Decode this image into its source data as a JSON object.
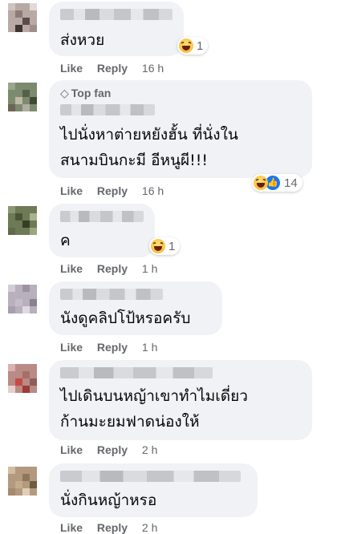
{
  "comments": [
    {
      "text_lines": [
        "ส่งหวย"
      ],
      "reactions": {
        "emojis": [
          "haha-icon"
        ],
        "count": "1"
      },
      "actions": {
        "like": "Like",
        "reply": "Reply",
        "time": "16 h"
      }
    },
    {
      "badge": "Top fan",
      "text_lines": [
        "ไปนั่งหาต่ายหยังฮั้น ที่นั่งใน",
        "สนามบินกะมี อีหนูผี!!!"
      ],
      "reactions": {
        "emojis": [
          "haha-icon",
          "like-icon"
        ],
        "count": "14"
      },
      "actions": {
        "like": "Like",
        "reply": "Reply",
        "time": "16 h"
      }
    },
    {
      "text_lines": [
        "ค"
      ],
      "reactions": {
        "emojis": [
          "haha-icon"
        ],
        "count": "1"
      },
      "actions": {
        "like": "Like",
        "reply": "Reply",
        "time": "1 h"
      }
    },
    {
      "text_lines": [
        "นังดูคลิปโป้หรอครับ"
      ],
      "actions": {
        "like": "Like",
        "reply": "Reply",
        "time": "1 h"
      }
    },
    {
      "text_lines": [
        "ไปเดินบนหญ้าเขาทำไมเดี่ยว",
        "ก้านมะยมฟาดน่องให้"
      ],
      "actions": {
        "like": "Like",
        "reply": "Reply",
        "time": "2 h"
      }
    },
    {
      "text_lines": [
        "นั่งกินหญ้าหรอ"
      ],
      "actions": {
        "like": "Like",
        "reply": "Reply",
        "time": "2 h"
      }
    }
  ],
  "colors": {
    "bubble": "#f0f2f5",
    "meta": "#65676b",
    "text": "#050505"
  }
}
